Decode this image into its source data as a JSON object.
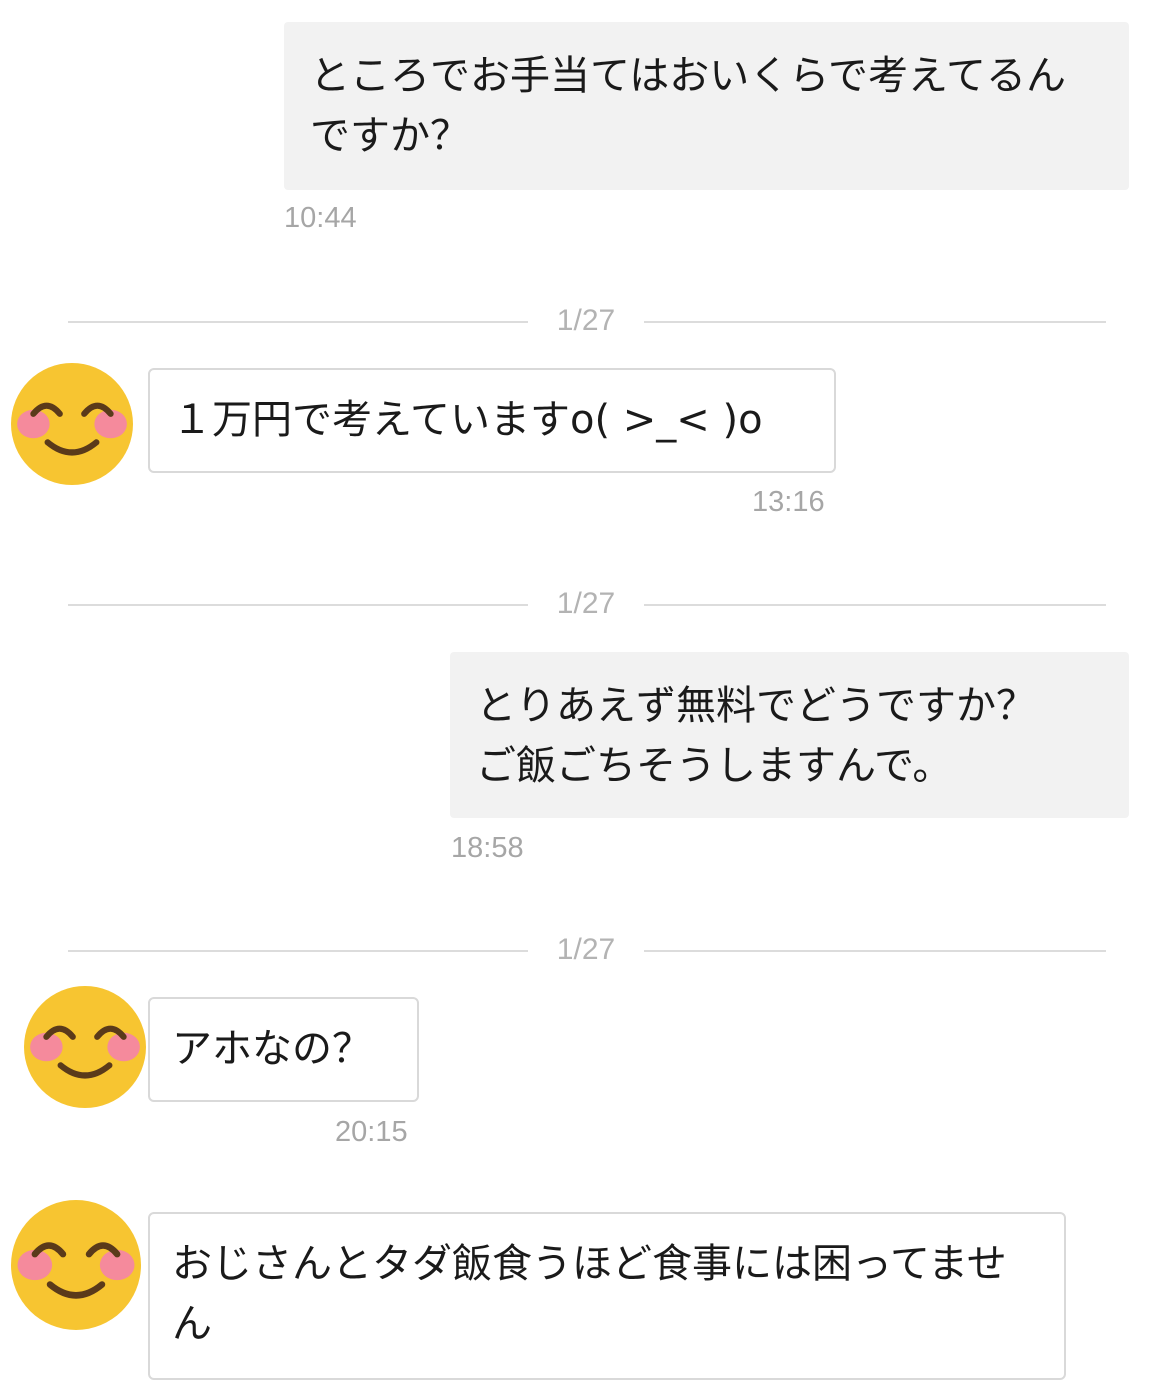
{
  "messages": [
    {
      "text": "ところでお手当てはおいくらで考えてるんですか？",
      "time": "10:44",
      "direction": "outgoing"
    },
    {
      "divider": "1/27"
    },
    {
      "text": "１万円で考えていますo( >_< )o",
      "time": "13:16",
      "direction": "incoming",
      "avatar": "smiling-face-icon"
    },
    {
      "divider": "1/27"
    },
    {
      "text": "とりあえず無料でどうですか？\nご飯ごちそうしますんで。",
      "time": "18:58",
      "direction": "outgoing"
    },
    {
      "divider": "1/27"
    },
    {
      "text": "アホなの？",
      "time": "20:15",
      "direction": "incoming",
      "avatar": "smiling-face-icon"
    },
    {
      "text": "おじさんとタダ飯食うほど食事には困ってません",
      "direction": "incoming",
      "avatar": "smiling-face-icon"
    }
  ],
  "colors": {
    "outgoing_bubble": "#f2f2f2",
    "incoming_border": "#d9d9d9",
    "timestamp": "#a6a6a6",
    "emoji_face": "#f7c531",
    "emoji_blush": "#f58a9c"
  }
}
